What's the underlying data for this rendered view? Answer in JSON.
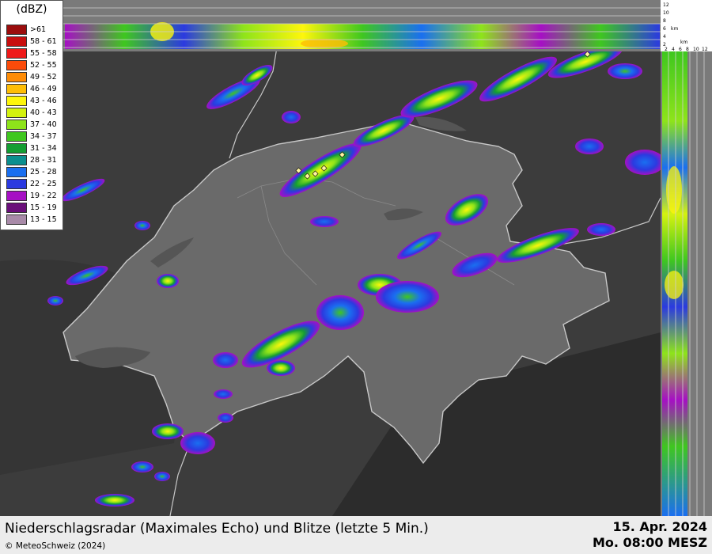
{
  "legend": {
    "title": "(dBZ)",
    "classes": [
      {
        "label": ">61",
        "color": "#9b0d0d"
      },
      {
        "label": "58 - 61",
        "color": "#c70f0f"
      },
      {
        "label": "55 - 58",
        "color": "#ef1a1a"
      },
      {
        "label": "52 - 55",
        "color": "#fb4b0a"
      },
      {
        "label": "49 - 52",
        "color": "#fe8c06"
      },
      {
        "label": "46 - 49",
        "color": "#febd06"
      },
      {
        "label": "43 - 46",
        "color": "#fef60b"
      },
      {
        "label": "40 - 43",
        "color": "#d4f20f"
      },
      {
        "label": "37 - 40",
        "color": "#8ee41a"
      },
      {
        "label": "34 - 37",
        "color": "#3fc71f"
      },
      {
        "label": "31 - 34",
        "color": "#149e33"
      },
      {
        "label": "28 - 31",
        "color": "#0b8f8f"
      },
      {
        "label": "25 - 28",
        "color": "#1a6ff0"
      },
      {
        "label": "22 - 25",
        "color": "#2b3ae0"
      },
      {
        "label": "19 - 22",
        "color": "#a60fc4"
      },
      {
        "label": "15 - 19",
        "color": "#6a0f7a"
      },
      {
        "label": "13 - 15",
        "color": "#a88aa8"
      }
    ]
  },
  "profile_top": {
    "height_ticks": [
      "12",
      "10",
      "8",
      "6",
      "4",
      "2"
    ],
    "unit": "km"
  },
  "profile_right": {
    "distance_ticks": [
      "2",
      "4",
      "6",
      "8",
      "10",
      "12"
    ],
    "unit": "km"
  },
  "footer": {
    "title": "Niederschlagsradar (Maximales Echo) und Blitze (letzte 5 Min.)",
    "copyright": "© MeteoSchweiz (2024)",
    "date": "15. Apr. 2024",
    "time": "Mo. 08:00 MESZ"
  },
  "colors": {
    "terrain": "#3c3c3c",
    "switzerland": "#6a6a6a",
    "border": "#c8c8c8",
    "profile_bg": "#7a7a7a",
    "lightning": "#fff4a0"
  }
}
